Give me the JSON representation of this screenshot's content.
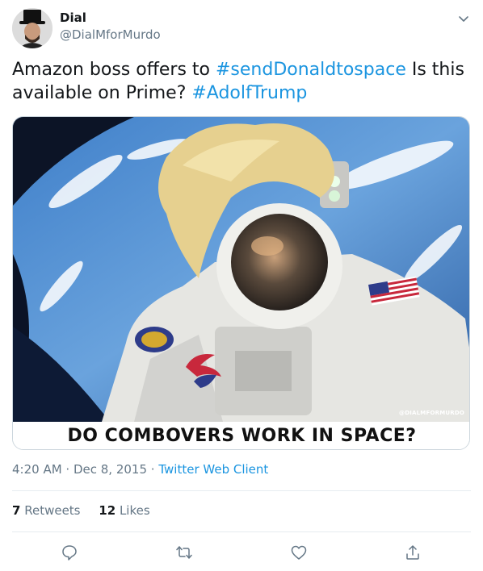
{
  "user": {
    "display_name": "Dial",
    "handle": "@DialMforMurdo"
  },
  "tweet": {
    "text_parts": [
      {
        "text": "Amazon boss offers to ",
        "type": "plain"
      },
      {
        "text": "#sendDonaldtospace",
        "type": "hashtag"
      },
      {
        "text": " Is this available on Prime? ",
        "type": "plain"
      },
      {
        "text": "#AdolfTrump",
        "type": "hashtag"
      }
    ]
  },
  "media": {
    "caption": "DO COMBOVERS WORK IN SPACE?",
    "watermark": "@DIALMFORMURDO"
  },
  "meta": {
    "time": "4:20 AM",
    "separator1": " · ",
    "date": "Dec 8, 2015",
    "separator2": " · ",
    "source": "Twitter Web Client"
  },
  "stats": {
    "retweets_count": "7",
    "retweets_label": "Retweets",
    "likes_count": "12",
    "likes_label": "Likes"
  },
  "actions": {
    "icons": [
      "reply-icon",
      "retweet-icon",
      "like-icon",
      "share-icon"
    ]
  },
  "colors": {
    "hashtag": "#1b95e0",
    "secondary_text": "#657786",
    "divider": "#e6ecf0"
  }
}
